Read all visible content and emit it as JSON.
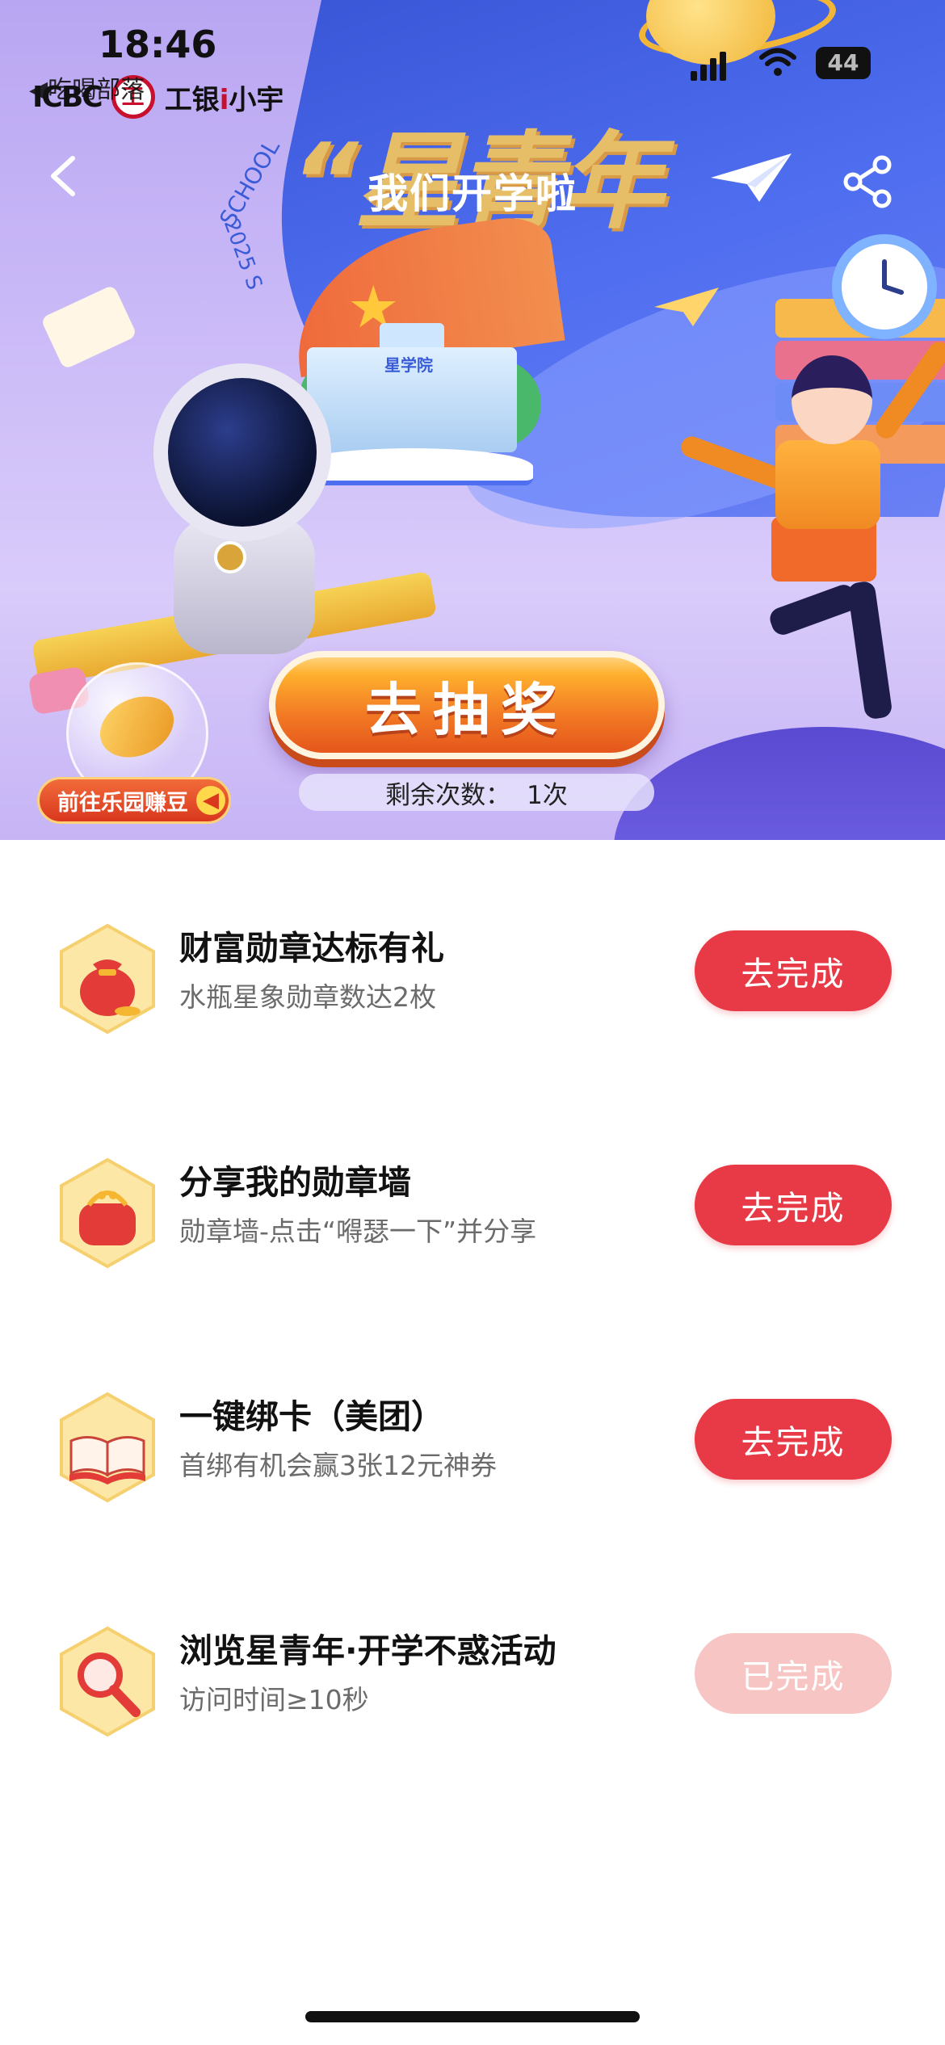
{
  "status_bar": {
    "time": "18:46",
    "back_app": "◀吃喝部落",
    "battery": "44"
  },
  "brand": {
    "bank": "ICBC",
    "logo_text": "工",
    "name_prefix": "工银",
    "name_accent": "i",
    "name_suffix": "小宇"
  },
  "hero": {
    "page_title": "我们开学啦",
    "banner_title": "“星青年",
    "school_text": "SCHOOL",
    "school_year": "2025 S",
    "school_building_label": "星学院",
    "draw_button": "去抽奖",
    "remaining_label": "剩余次数：",
    "remaining_value": "1次",
    "earn_beans": "前往乐园赚豆"
  },
  "tasks": [
    {
      "title": "财富勋章达标有礼",
      "desc": "水瓶星象勋章数达2枚",
      "button": "去完成",
      "status": "todo",
      "icon": "money-bag-icon"
    },
    {
      "title": "分享我的勋章墙",
      "desc": "勋章墙-点击“嘚瑟一下”并分享",
      "button": "去完成",
      "status": "todo",
      "icon": "coin-purse-icon"
    },
    {
      "title": "一键绑卡（美团）",
      "desc": "首绑有机会赢3张12元神券",
      "button": "去完成",
      "status": "todo",
      "icon": "open-book-icon"
    },
    {
      "title": "浏览星青年·开学不惑活动",
      "desc": "访问时间≥10秒",
      "button": "已完成",
      "status": "done",
      "icon": "magnifier-icon"
    }
  ],
  "colors": {
    "accent_red": "#e83a46",
    "done_pink": "#f7c5c3",
    "hero_blue": "#4f6ef0",
    "draw_orange": "#f27a24"
  }
}
